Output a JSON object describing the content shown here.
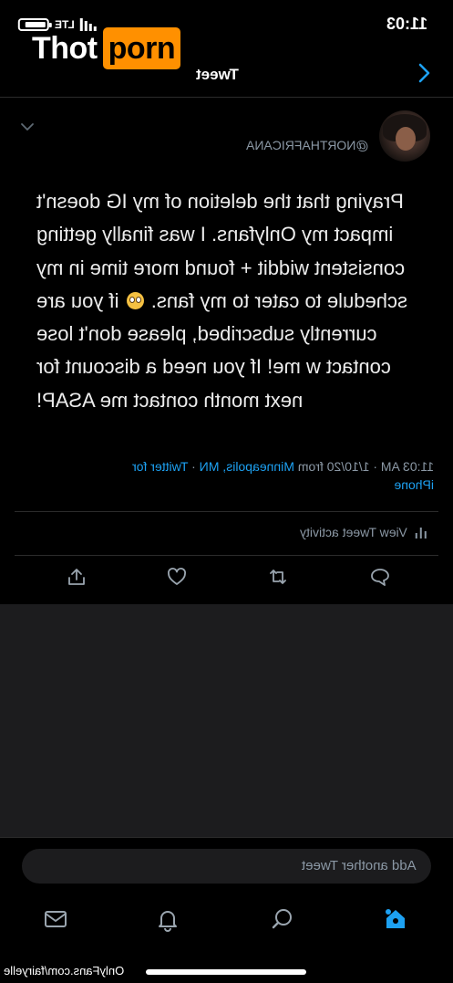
{
  "status_bar": {
    "time": "11:03",
    "network": "LTE",
    "signal_bars": 4
  },
  "watermark": {
    "part1": "Thot",
    "part2": "porn",
    "accent_color": "#ff9000",
    "onlyfans_text": "OnlyFans.com/fairyelle"
  },
  "header": {
    "title": "Tweet",
    "back_icon": "chevron-left-icon"
  },
  "tweet": {
    "handle": "@NORTHAFRICANA",
    "body_lines": [
      "Praying that the deletion of my IG doesn't",
      "impact my Onlyfans. I was finally getting",
      "consistent widdit + found more time in my",
      "schedule to cater to my fans. [emoji] if you are",
      "currently subscribed, please don't lose",
      "contact w me! If you need a discount for",
      "next month contact me ASAP!"
    ],
    "emoji_name": "pleading-face",
    "meta_time": "11:03 AM · 1/10/20 from ",
    "meta_location": "Minneapolis, MN",
    "meta_sep": " · ",
    "meta_client_1": "Twitter for",
    "meta_client_2": "iPhone",
    "activity_label": "View Tweet activity"
  },
  "actions": [
    "reply-icon",
    "retweet-icon",
    "like-icon",
    "share-icon"
  ],
  "composer": {
    "placeholder": "Add another Tweet"
  },
  "tabbar": [
    "home-icon",
    "search-icon",
    "notifications-icon",
    "messages-icon"
  ],
  "colors": {
    "link": "#1da1f2",
    "secondary_text": "#8b98a5",
    "background": "#000000",
    "panel": "#1c1c1e"
  }
}
